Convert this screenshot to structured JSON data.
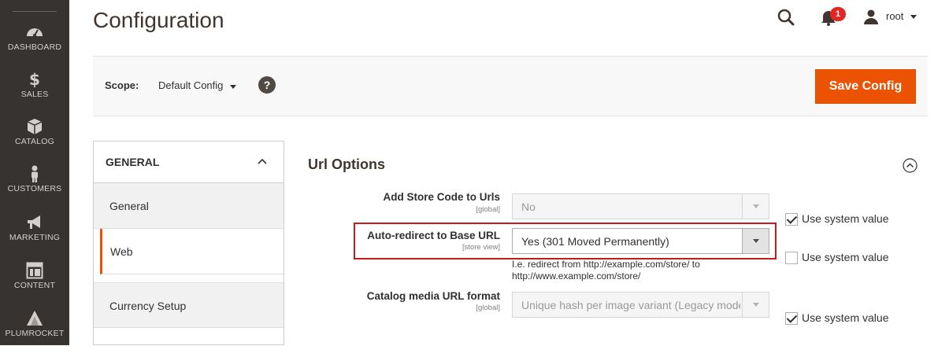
{
  "sidebar": {
    "items": [
      {
        "label": "DASHBOARD",
        "icon": "dashboard-icon"
      },
      {
        "label": "SALES",
        "icon": "dollar-icon"
      },
      {
        "label": "CATALOG",
        "icon": "cube-icon"
      },
      {
        "label": "CUSTOMERS",
        "icon": "person-icon"
      },
      {
        "label": "MARKETING",
        "icon": "megaphone-icon"
      },
      {
        "label": "CONTENT",
        "icon": "layout-icon"
      },
      {
        "label": "PLUMROCKET",
        "icon": "plumrocket-logo-icon"
      }
    ]
  },
  "header": {
    "title": "Configuration",
    "notifications_count": "1",
    "user_name": "root"
  },
  "scope": {
    "label": "Scope:",
    "value": "Default Config",
    "help": "?",
    "save_label": "Save Config"
  },
  "tabs": {
    "group_label": "GENERAL",
    "items": [
      {
        "label": "General",
        "active": false
      },
      {
        "label": "Web",
        "active": true
      },
      {
        "label": "Currency Setup",
        "active": false
      }
    ]
  },
  "section": {
    "title": "Url Options",
    "fields": [
      {
        "label": "Add Store Code to Urls",
        "scope": "[global]",
        "value": "No",
        "disabled": true,
        "use_system_value_label": "Use system value",
        "use_system_value": true
      },
      {
        "label": "Auto-redirect to Base URL",
        "scope": "[store view]",
        "value": "Yes (301 Moved Permanently)",
        "disabled": false,
        "note": "I.e. redirect from http://example.com/store/ to http://www.example.com/store/",
        "use_system_value_label": "Use system value",
        "use_system_value": false
      },
      {
        "label": "Catalog media URL format",
        "scope": "[global]",
        "value": "Unique hash per image variant (Legacy mode)",
        "disabled": true,
        "use_system_value_label": "Use system value",
        "use_system_value": true
      }
    ]
  },
  "colors": {
    "sidebar_bg": "#373330",
    "accent": "#eb5202",
    "highlight": "#c91a1a",
    "badge": "#e22626"
  }
}
